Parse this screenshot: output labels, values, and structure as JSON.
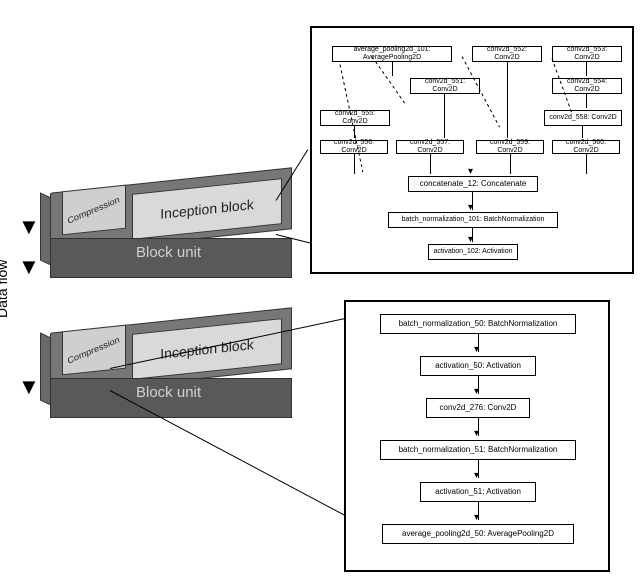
{
  "left": {
    "data_flow_label": "Data flow",
    "unit1": {
      "compression_label": "Compression",
      "inception_label": "Inception block",
      "front_label": "Block unit"
    },
    "unit2": {
      "compression_label": "Compression",
      "inception_label": "Inception block",
      "front_label": "Block unit"
    }
  },
  "chart_data": {
    "type": "diagram",
    "title": "",
    "blocks": [
      {
        "name": "Block unit",
        "contains": [
          "Compression",
          "Inception block"
        ]
      },
      {
        "name": "Block unit",
        "contains": [
          "Compression",
          "Inception block"
        ]
      }
    ],
    "inception_detail_nodes": [
      "average_pooling2d_101: AveragePooling2D",
      "conv2d_552: Conv2D",
      "conv2d_553: Conv2D",
      "conv2d_551: Conv2D",
      "conv2d_554: Conv2D",
      "conv2d_555: Conv2D",
      "conv2d_558: Conv2D",
      "conv2d_556: Conv2D",
      "conv2d_557: Conv2D",
      "conv2d_559: Conv2D",
      "conv2d_560: Conv2D",
      "concatenate_12: Concatenate",
      "batch_normalization_101: BatchNormalization",
      "activation_102: Activation"
    ],
    "compression_detail_nodes": [
      "batch_normalization_50: BatchNormalization",
      "activation_50: Activation",
      "conv2d_276: Conv2D",
      "batch_normalization_51: BatchNormalization",
      "activation_51: Activation",
      "average_pooling2d_50: AveragePooling2D"
    ]
  },
  "p1": {
    "n_avgpool": "average_pooling2d_101: AveragePooling2D",
    "n_c552": "conv2d_552: Conv2D",
    "n_c553": "conv2d_553: Conv2D",
    "n_c551": "conv2d_551: Conv2D",
    "n_c554": "conv2d_554: Conv2D",
    "n_c555": "conv2d_555: Conv2D",
    "n_c558": "conv2d_558: Conv2D",
    "n_c556": "conv2d_556: Conv2D",
    "n_c557": "conv2d_557: Conv2D",
    "n_c559": "conv2d_559: Conv2D",
    "n_c560": "conv2d_560: Conv2D",
    "n_concat": "concatenate_12: Concatenate",
    "n_bn": "batch_normalization_101: BatchNormalization",
    "n_act": "activation_102: Activation"
  },
  "p2": {
    "n_bn50": "batch_normalization_50: BatchNormalization",
    "n_act50": "activation_50: Activation",
    "n_conv": "conv2d_276: Conv2D",
    "n_bn51": "batch_normalization_51: BatchNormalization",
    "n_act51": "activation_51: Activation",
    "n_avg": "average_pooling2d_50: AveragePooling2D"
  }
}
